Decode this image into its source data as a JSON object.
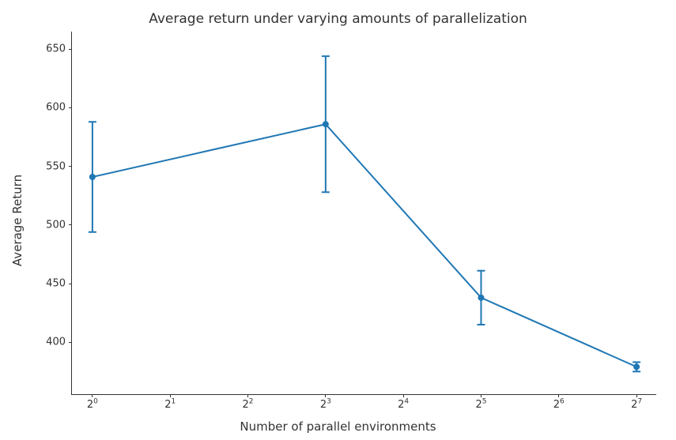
{
  "chart_data": {
    "type": "line",
    "title": "Average return under varying amounts of parallelization",
    "xlabel": "Number of parallel environments",
    "ylabel": "Average Return",
    "xscale": "log2",
    "xticks": [
      1,
      2,
      4,
      8,
      16,
      32,
      64,
      128
    ],
    "xtick_labels": [
      "2^0",
      "2^1",
      "2^2",
      "2^3",
      "2^4",
      "2^5",
      "2^6",
      "2^7"
    ],
    "ylim": [
      355,
      665
    ],
    "yticks": [
      400,
      450,
      500,
      550,
      600,
      650
    ],
    "color": "#1f77b4",
    "series": [
      {
        "name": "avg_return",
        "x": [
          1,
          8,
          32,
          128
        ],
        "y": [
          541,
          586,
          438,
          379
        ],
        "yerr": [
          47,
          58,
          23,
          4
        ]
      }
    ]
  }
}
